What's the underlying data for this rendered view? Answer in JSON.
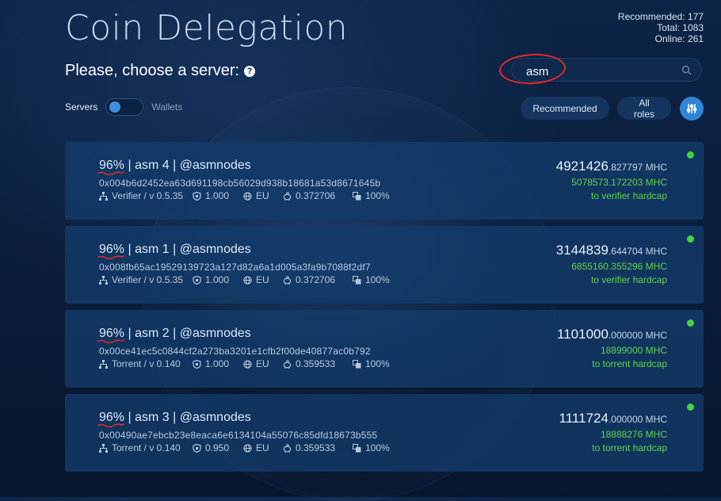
{
  "title": "Coin Delegation",
  "stats": {
    "recommended": "Recommended: 177",
    "total": "Total: 1083",
    "online": "Online: 261"
  },
  "subtitle": "Please, choose a server:",
  "search": {
    "value": "asm"
  },
  "toggle": {
    "left_label": "Servers",
    "right_label": "Wallets"
  },
  "filters": {
    "recommended": "Recommended",
    "all_roles": "All roles"
  },
  "colors": {
    "accent": "#2f86d6",
    "green": "#5fd24a",
    "status_online": "#3fd53d",
    "annotation": "#e22b2b"
  },
  "servers": [
    {
      "percent": "96%",
      "name": " | asm 4 | @asmnodes",
      "address": "0x004b6d2452ea63d691198cb56029d938b18681a53d8671645b",
      "role": "Verifier / v 0.5.35",
      "ratio": "1.000",
      "region": "EU",
      "reward": "0.372706",
      "uptime": "100%",
      "amount_int": "4921426",
      "amount_dec": ".827797 MHC",
      "available": "5078573.172203 MHC",
      "hardcap": "to verifier hardcap"
    },
    {
      "percent": "96%",
      "name": " | asm 1 | @asmnodes",
      "address": "0x008fb65ac19529139723a127d82a6a1d005a3fa9b7088f2df7",
      "role": "Verifier / v 0.5.35",
      "ratio": "1.000",
      "region": "EU",
      "reward": "0.372706",
      "uptime": "100%",
      "amount_int": "3144839",
      "amount_dec": ".644704 MHC",
      "available": "6855160.355296 MHC",
      "hardcap": "to verifier hardcap"
    },
    {
      "percent": "96%",
      "name": " | asm 2 | @asmnodes",
      "address": "0x00ce41ec5c0844cf2a273ba3201e1cfb2f00de40877ac0b792",
      "role": "Torrent / v 0.140",
      "ratio": "1.000",
      "region": "EU",
      "reward": "0.359533",
      "uptime": "100%",
      "amount_int": "1101000",
      "amount_dec": ".000000 MHC",
      "available": "18899000 MHC",
      "hardcap": "to torrent hardcap"
    },
    {
      "percent": "96%",
      "name": " | asm 3 | @asmnodes",
      "address": "0x00490ae7ebcb23e8eaca6e6134104a55076c85dfd18673b555",
      "role": "Torrent / v 0.140",
      "ratio": "0.950",
      "region": "EU",
      "reward": "0.359533",
      "uptime": "100%",
      "amount_int": "1111724",
      "amount_dec": ".000000 MHC",
      "available": "18888276 MHC",
      "hardcap": "to torrent hardcap"
    }
  ]
}
